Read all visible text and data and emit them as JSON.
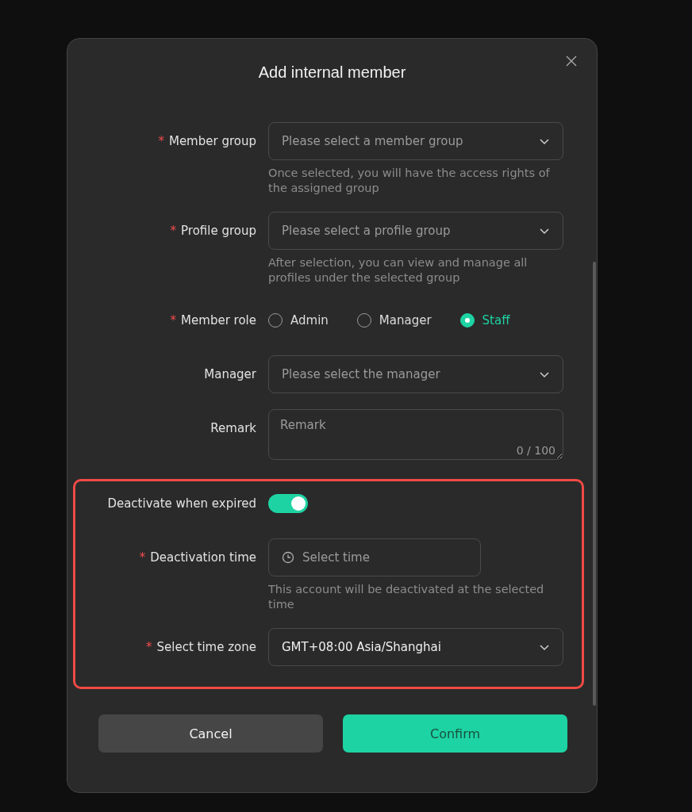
{
  "dialog": {
    "title": "Add internal member",
    "fields": [
      {
        "kind": "select",
        "required_mark": "*",
        "label": "Member group",
        "placeholder": "Please select a member group",
        "help": "Once selected, you will have the access rights of the assigned group"
      },
      {
        "kind": "select",
        "required_mark": "*",
        "label": "Profile group",
        "placeholder": "Please select a profile group",
        "help": "After selection, you can view and manage all profiles under the selected group"
      },
      {
        "kind": "radio",
        "required_mark": "*",
        "label": "Member role",
        "options": [
          {
            "label": "Admin",
            "selected": false
          },
          {
            "label": "Manager",
            "selected": false
          },
          {
            "label": "Staff",
            "selected": true
          }
        ]
      },
      {
        "kind": "select",
        "label": "Manager",
        "placeholder": "Please select the manager"
      },
      {
        "kind": "textarea",
        "label": "Remark",
        "placeholder": "Remark",
        "counter": "0 / 100"
      }
    ],
    "highlighted_fields": [
      {
        "kind": "toggle",
        "label": "Deactivate when expired",
        "on": true
      },
      {
        "kind": "time",
        "required_mark": "*",
        "label": "Deactivation time",
        "placeholder": "Select time",
        "help": "This account will be deactivated at the selected time"
      },
      {
        "kind": "select",
        "required_mark": "*",
        "label": "Select time zone",
        "value": "GMT+08:00 Asia/Shanghai"
      }
    ],
    "buttons": [
      {
        "label": "Cancel",
        "kind": "secondary"
      },
      {
        "label": "Confirm",
        "kind": "primary"
      }
    ]
  }
}
